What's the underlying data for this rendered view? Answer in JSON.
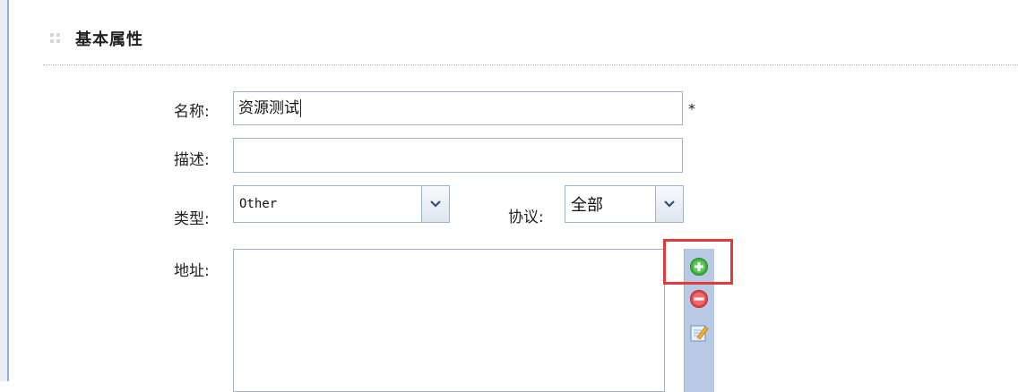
{
  "section": {
    "title": "基本属性"
  },
  "form": {
    "name": {
      "label": "名称:",
      "value": "资源测试",
      "required_mark": "*"
    },
    "description": {
      "label": "描述:",
      "value": ""
    },
    "type": {
      "label": "类型:",
      "selected": "Other"
    },
    "protocol": {
      "label": "协议:",
      "selected": "全部"
    },
    "address": {
      "label": "地址:"
    }
  },
  "address_toolbar": {
    "add": {
      "icon": "add-icon",
      "color": "#3cae3c"
    },
    "remove": {
      "icon": "remove-icon",
      "color": "#e2454a"
    },
    "edit": {
      "icon": "edit-icon"
    }
  },
  "highlight_color": "#e03a3a"
}
